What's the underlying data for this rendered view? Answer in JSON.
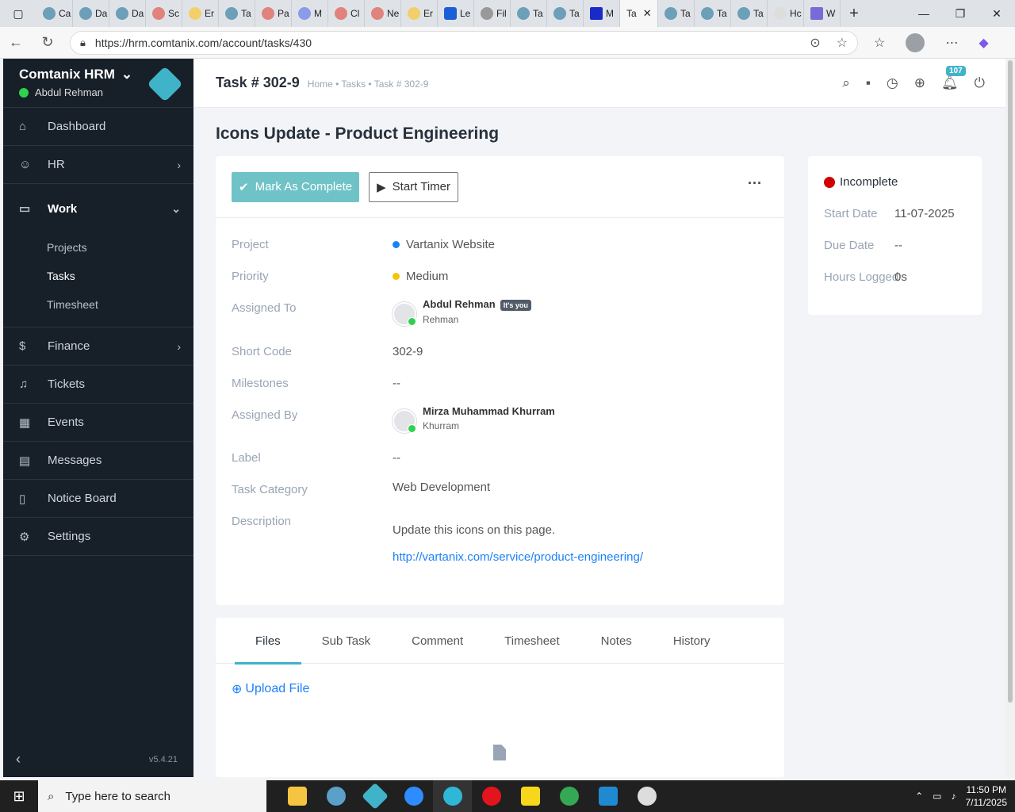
{
  "browser": {
    "tabs": [
      {
        "label": "Ca"
      },
      {
        "label": "Da"
      },
      {
        "label": "Da"
      },
      {
        "label": "Sc"
      },
      {
        "label": "Er"
      },
      {
        "label": "Ta"
      },
      {
        "label": "Pa"
      },
      {
        "label": "M"
      },
      {
        "label": "Cl"
      },
      {
        "label": "Ne"
      },
      {
        "label": "Er"
      },
      {
        "label": "Le"
      },
      {
        "label": "Fil"
      },
      {
        "label": "Ta"
      },
      {
        "label": "Ta"
      },
      {
        "label": "M"
      },
      {
        "label": "Ta"
      },
      {
        "label": "Ta"
      },
      {
        "label": "Ta"
      },
      {
        "label": "Ta"
      },
      {
        "label": "Hc"
      },
      {
        "label": "W"
      }
    ],
    "url": "https://hrm.comtanix.com/account/tasks/430"
  },
  "sidebar": {
    "brand": "Comtanix HRM",
    "user": "Abdul Rehman",
    "items": [
      {
        "label": "Dashboard",
        "icon": "home-icon"
      },
      {
        "label": "HR",
        "icon": "users-icon"
      },
      {
        "label": "Work",
        "icon": "briefcase-icon"
      },
      {
        "label": "Finance",
        "icon": "dollar-icon"
      },
      {
        "label": "Tickets",
        "icon": "headset-icon"
      },
      {
        "label": "Events",
        "icon": "calendar-icon"
      },
      {
        "label": "Messages",
        "icon": "message-icon"
      },
      {
        "label": "Notice Board",
        "icon": "clipboard-icon"
      },
      {
        "label": "Settings",
        "icon": "gear-icon"
      }
    ],
    "work_sub": [
      "Projects",
      "Tasks",
      "Timesheet"
    ],
    "version": "v5.4.21"
  },
  "header": {
    "title": "Task # 302-9",
    "breadcrumb": "Home • Tasks • Task # 302-9",
    "notification_count": "107"
  },
  "task": {
    "heading": "Icons Update - Product Engineering",
    "mark_complete_label": "Mark As Complete",
    "start_timer_label": "Start Timer",
    "fields": {
      "project_label": "Project",
      "project_value": "Vartanix Website",
      "priority_label": "Priority",
      "priority_value": "Medium",
      "assigned_to_label": "Assigned To",
      "assigned_to_name": "Abdul Rehman",
      "assigned_to_badge": "It's you",
      "assigned_to_sub": "Rehman",
      "short_code_label": "Short Code",
      "short_code_value": "302-9",
      "milestones_label": "Milestones",
      "milestones_value": "--",
      "assigned_by_label": "Assigned By",
      "assigned_by_name": "Mirza Muhammad Khurram",
      "assigned_by_sub": "Khurram",
      "label_label": "Label",
      "label_value": "--",
      "category_label": "Task Category",
      "category_value": "Web Development",
      "description_label": "Description",
      "description_text": "Update this icons on this page.",
      "description_link": "http://vartanix.com/service/product-engineering/"
    },
    "colors": {
      "project_dot": "#1d82f5",
      "priority_dot": "#f5c308",
      "status_dot": "#d30000",
      "accent": "#3fb3c8"
    }
  },
  "status": {
    "state": "Incomplete",
    "start_date_label": "Start Date",
    "start_date_value": "11-07-2025",
    "due_date_label": "Due Date",
    "due_date_value": "--",
    "hours_label": "Hours Logged",
    "hours_value": "0s"
  },
  "bottom_tabs": [
    "Files",
    "Sub Task",
    "Comment",
    "Timesheet",
    "Notes",
    "History"
  ],
  "upload_label": "Upload File",
  "taskbar": {
    "search_placeholder": "Type here to search",
    "time": "11:50 PM",
    "date": "7/11/2025"
  }
}
